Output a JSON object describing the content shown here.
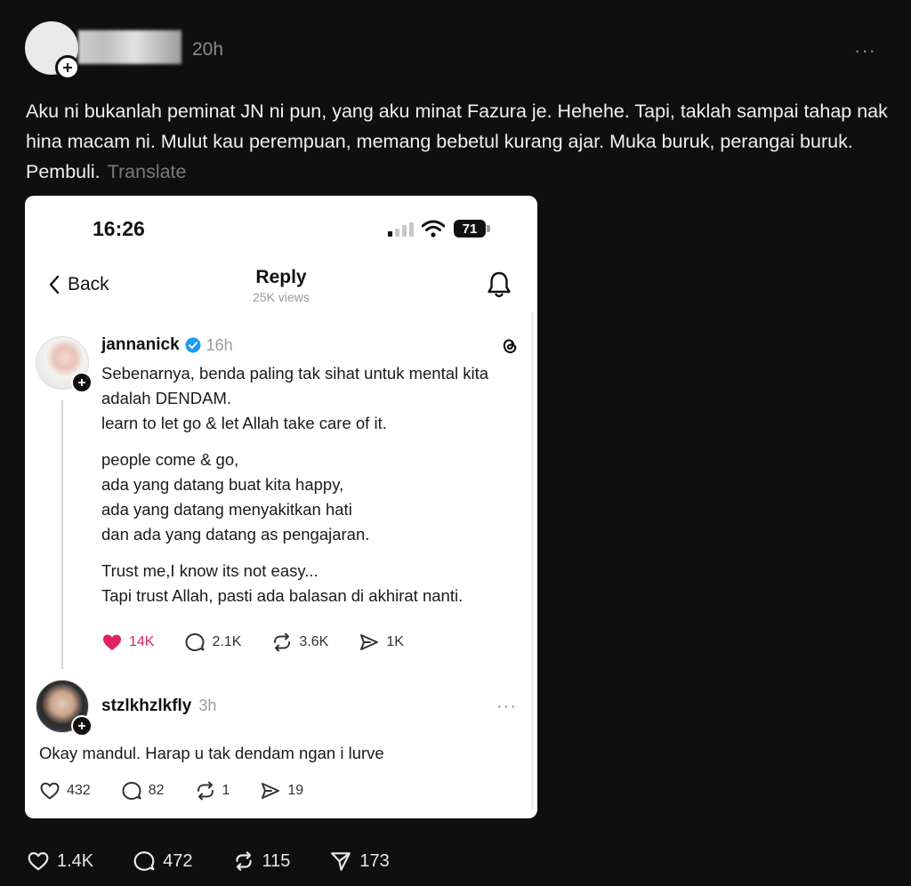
{
  "post": {
    "time": "20h",
    "more": "···",
    "text": "Aku ni bukanlah peminat JN ni pun, yang aku minat Fazura je. Hehehe. Tapi, taklah sampai tahap nak hina macam ni. Mulut kau perempuan, memang bebetul kurang ajar. Muka buruk, perangai buruk. Pembuli.",
    "translate": "Translate",
    "actions": {
      "likes": "1.4K",
      "comments": "472",
      "reposts": "115",
      "shares": "173"
    }
  },
  "screenshot": {
    "status_time": "16:26",
    "battery": "71",
    "back_label": "Back",
    "title": "Reply",
    "views": "25K views",
    "original_post": {
      "username": "jannanick",
      "time": "16h",
      "paragraphs": [
        "Sebenarnya, benda paling tak sihat untuk mental kita adalah DENDAM.",
        "learn to let go & let Allah take care of it.",
        "people come & go,",
        "ada yang datang buat kita happy,",
        "ada yang datang menyakitkan hati",
        "dan ada yang datang as pengajaran.",
        "Trust me,I know its not easy...",
        "Tapi trust Allah, pasti ada balasan di akhirat nanti."
      ],
      "likes": "14K",
      "comments": "2.1K",
      "reposts": "3.6K",
      "shares": "1K"
    },
    "reply": {
      "username": "stzlkhzlkfly",
      "time": "3h",
      "more": "···",
      "text": "Okay mandul. Harap u tak dendam ngan i lurve",
      "likes": "432",
      "comments": "82",
      "reposts": "1",
      "shares": "19"
    }
  },
  "colors": {
    "background": "#0f0f0f",
    "like_red": "#e0245e",
    "verified_blue": "#1d9bf0"
  }
}
